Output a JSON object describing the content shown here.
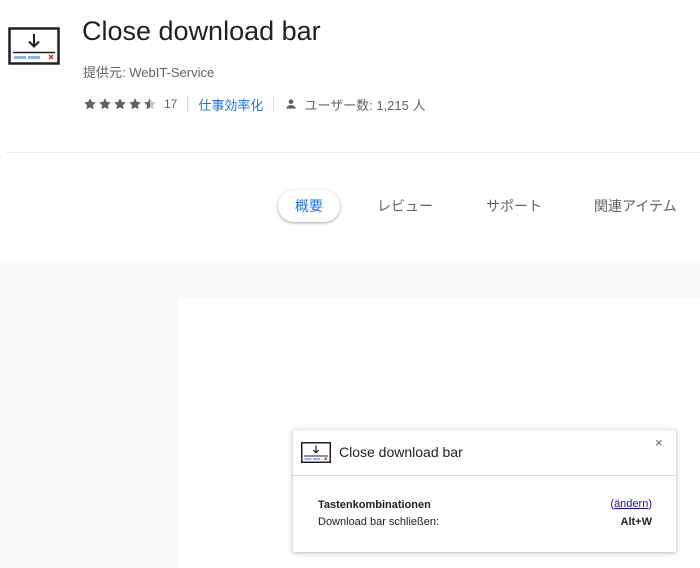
{
  "extension": {
    "title": "Close download bar",
    "provider": "提供元: WebIT-Service",
    "rating_value": 4.5,
    "rating_count": "17",
    "category": "仕事効率化",
    "users": "ユーザー数: 1,215 人",
    "icon": "download-tray-icon"
  },
  "tabs": [
    {
      "label": "概要",
      "active": true
    },
    {
      "label": "レビュー",
      "active": false
    },
    {
      "label": "サポート",
      "active": false
    },
    {
      "label": "関連アイテム",
      "active": false
    }
  ],
  "popup": {
    "title": "Close download bar",
    "close_label": "×",
    "heading": "Tastenkombinationen",
    "change_open": "(",
    "change_label": "ändern",
    "change_close": ")",
    "shortcut_label": "Download bar schließen:",
    "shortcut_keys": "Alt+W"
  },
  "colors": {
    "link": "#1a73e8",
    "star": "#5f6368",
    "text": "#202124",
    "muted": "#5f6368"
  }
}
